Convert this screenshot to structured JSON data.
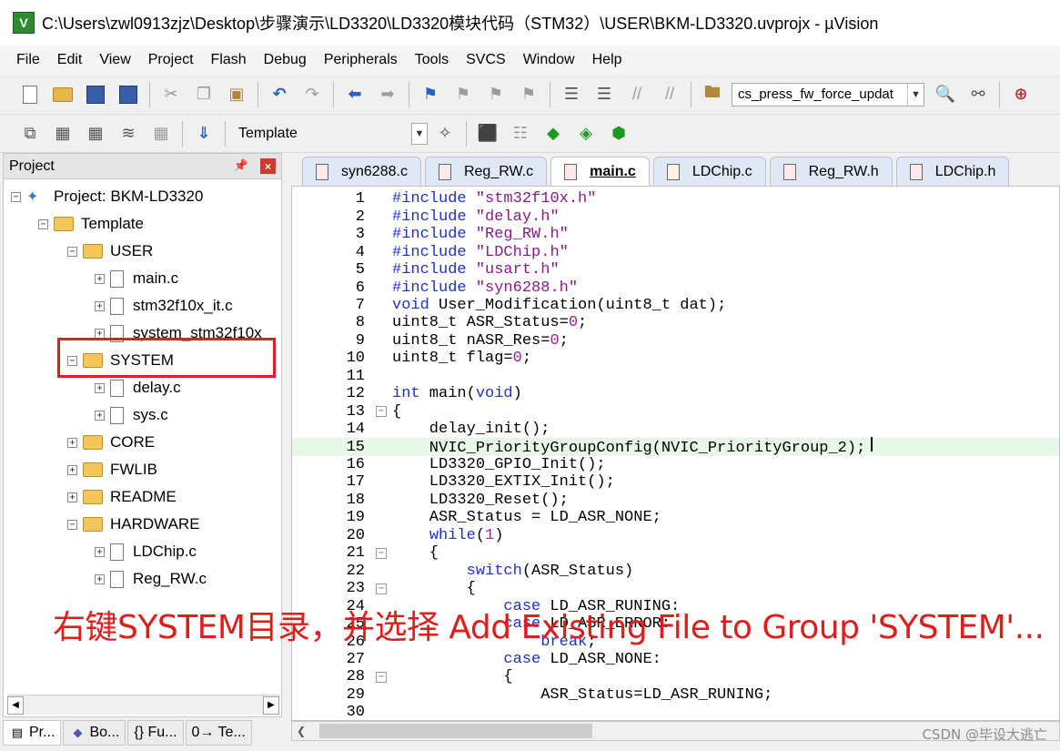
{
  "window": {
    "title": "C:\\Users\\zwl0913zjz\\Desktop\\步骤演示\\LD3320\\LD3320模块代码（STM32）\\USER\\BKM-LD3320.uvprojx - µVision"
  },
  "menu": [
    "File",
    "Edit",
    "View",
    "Project",
    "Flash",
    "Debug",
    "Peripherals",
    "Tools",
    "SVCS",
    "Window",
    "Help"
  ],
  "toolbar": {
    "find_combo": "cs_press_fw_force_updat",
    "target_combo": "Template"
  },
  "project_panel": {
    "title": "Project",
    "tree": [
      {
        "label": "Project: BKM-LD3320",
        "type": "project",
        "level": 0,
        "expander": "−"
      },
      {
        "label": "Template",
        "type": "folder",
        "level": 1,
        "expander": "−"
      },
      {
        "label": "USER",
        "type": "folder",
        "level": 2,
        "expander": "−"
      },
      {
        "label": "main.c",
        "type": "file",
        "level": 3,
        "expander": "+"
      },
      {
        "label": "stm32f10x_it.c",
        "type": "file",
        "level": 3,
        "expander": "+"
      },
      {
        "label": "system_stm32f10x",
        "type": "file",
        "level": 3,
        "expander": "+"
      },
      {
        "label": "SYSTEM",
        "type": "folder",
        "level": 2,
        "expander": "−"
      },
      {
        "label": "delay.c",
        "type": "file",
        "level": 3,
        "expander": "+"
      },
      {
        "label": "sys.c",
        "type": "file",
        "level": 3,
        "expander": "+"
      },
      {
        "label": "CORE",
        "type": "folder",
        "level": 2,
        "expander": "+"
      },
      {
        "label": "FWLIB",
        "type": "folder",
        "level": 2,
        "expander": "+"
      },
      {
        "label": "README",
        "type": "folder",
        "level": 2,
        "expander": "+"
      },
      {
        "label": "HARDWARE",
        "type": "folder",
        "level": 2,
        "expander": "−"
      },
      {
        "label": "LDChip.c",
        "type": "file",
        "level": 3,
        "expander": "+"
      },
      {
        "label": "Reg_RW.c",
        "type": "file",
        "level": 3,
        "expander": "+"
      }
    ]
  },
  "bottom_tabs": [
    "Pr...",
    "Bo...",
    "{} Fu...",
    "0→ Te..."
  ],
  "editor_tabs": [
    {
      "label": "syn6288.c",
      "kind": "c",
      "active": false
    },
    {
      "label": "Reg_RW.c",
      "kind": "c",
      "active": false
    },
    {
      "label": "main.c",
      "kind": "c",
      "active": true
    },
    {
      "label": "LDChip.c",
      "kind": "h",
      "active": false
    },
    {
      "label": "Reg_RW.h",
      "kind": "c",
      "active": false
    },
    {
      "label": "LDChip.h",
      "kind": "c",
      "active": false
    }
  ],
  "code_lines": [
    {
      "n": "1",
      "fold": "",
      "text": "#include \"stm32f10x.h\""
    },
    {
      "n": "2",
      "fold": "",
      "text": "#include \"delay.h\""
    },
    {
      "n": "3",
      "fold": "",
      "text": "#include \"Reg_RW.h\""
    },
    {
      "n": "4",
      "fold": "",
      "text": "#include \"LDChip.h\""
    },
    {
      "n": "5",
      "fold": "",
      "text": "#include \"usart.h\""
    },
    {
      "n": "6",
      "fold": "",
      "text": "#include \"syn6288.h\""
    },
    {
      "n": "7",
      "fold": "",
      "text": "void User_Modification(uint8_t dat);"
    },
    {
      "n": "8",
      "fold": "",
      "text": "uint8_t ASR_Status=0;"
    },
    {
      "n": "9",
      "fold": "",
      "text": "uint8_t nASR_Res=0;"
    },
    {
      "n": "10",
      "fold": "",
      "text": "uint8_t flag=0;"
    },
    {
      "n": "11",
      "fold": "",
      "text": ""
    },
    {
      "n": "12",
      "fold": "",
      "text": "int main(void)"
    },
    {
      "n": "13",
      "fold": "−",
      "text": "{"
    },
    {
      "n": "14",
      "fold": "",
      "text": "    delay_init();"
    },
    {
      "n": "15",
      "fold": "",
      "text": "    NVIC_PriorityGroupConfig(NVIC_PriorityGroup_2);"
    },
    {
      "n": "16",
      "fold": "",
      "text": "    LD3320_GPIO_Init();"
    },
    {
      "n": "17",
      "fold": "",
      "text": "    LD3320_EXTIX_Init();"
    },
    {
      "n": "18",
      "fold": "",
      "text": "    LD3320_Reset();"
    },
    {
      "n": "19",
      "fold": "",
      "text": "    ASR_Status = LD_ASR_NONE;"
    },
    {
      "n": "20",
      "fold": "",
      "text": "    while(1)"
    },
    {
      "n": "21",
      "fold": "−",
      "text": "    {"
    },
    {
      "n": "22",
      "fold": "",
      "text": "        switch(ASR_Status)"
    },
    {
      "n": "23",
      "fold": "−",
      "text": "        {"
    },
    {
      "n": "24",
      "fold": "",
      "text": "            case LD_ASR_RUNING:"
    },
    {
      "n": "25",
      "fold": "",
      "text": "            case LD_ASR_ERROR:"
    },
    {
      "n": "26",
      "fold": "",
      "text": "                break;"
    },
    {
      "n": "27",
      "fold": "",
      "text": "            case LD_ASR_NONE:"
    },
    {
      "n": "28",
      "fold": "−",
      "text": "            {"
    },
    {
      "n": "29",
      "fold": "",
      "text": "                ASR_Status=LD_ASR_RUNING;"
    },
    {
      "n": "30",
      "fold": "",
      "text": ""
    }
  ],
  "caption": "右键SYSTEM目录，并选择 Add Existing File to Group 'SYSTEM'...",
  "watermark": "CSDN @毕设大逃亡",
  "colors": {
    "caption": "#e21b1b",
    "highlight_box": "#e02020",
    "keyword": "#2030d0",
    "string": "#8a1a8a"
  }
}
